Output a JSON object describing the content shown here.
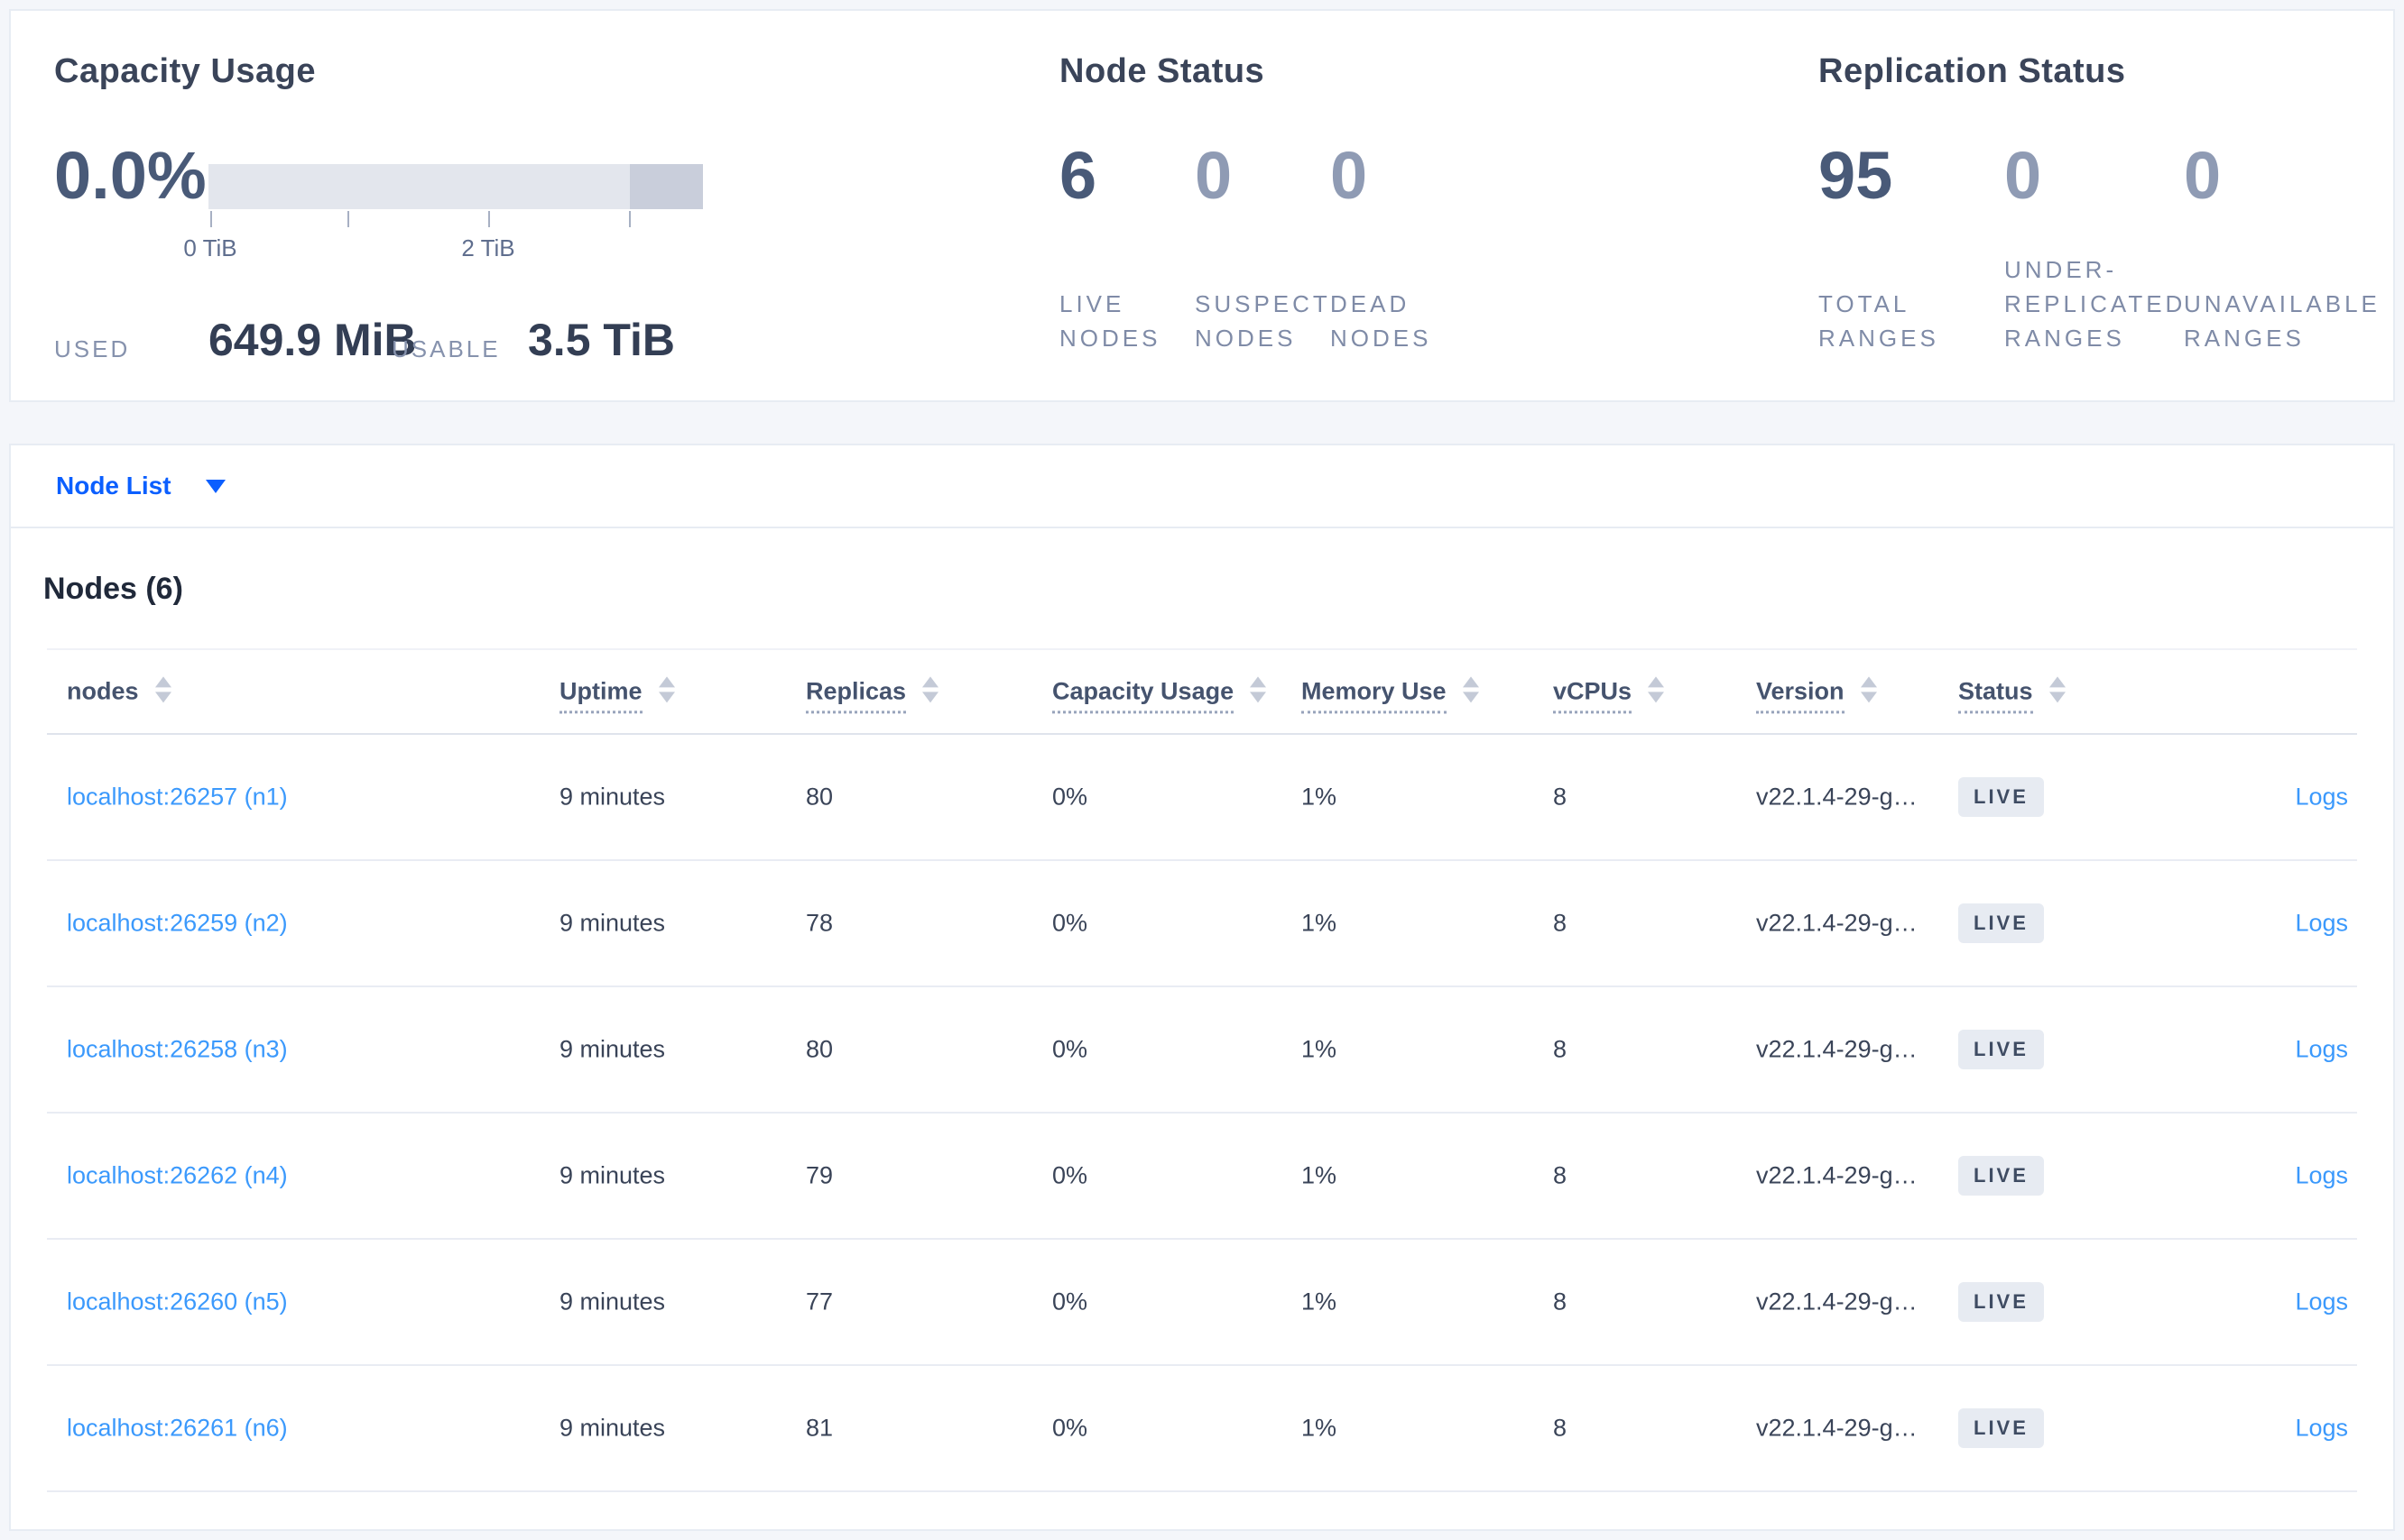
{
  "overview": {
    "capacity": {
      "title": "Capacity Usage",
      "percent": "0.0%",
      "tick_labels": [
        "0 TiB",
        "2 TiB"
      ],
      "used_label": "USED",
      "used_value": "649.9 MiB",
      "usable_label": "USABLE",
      "usable_value": "3.5 TiB"
    },
    "node_status": {
      "title": "Node Status",
      "stats": [
        {
          "value": "6",
          "label": "LIVE\nNODES"
        },
        {
          "value": "0",
          "label": "SUSPECT\nNODES"
        },
        {
          "value": "0",
          "label": "DEAD\nNODES"
        }
      ]
    },
    "replication": {
      "title": "Replication Status",
      "stats": [
        {
          "value": "95",
          "label": "TOTAL\nRANGES"
        },
        {
          "value": "0",
          "label": "UNDER-\nREPLICATED\nRANGES"
        },
        {
          "value": "0",
          "label": "UNAVAILABLE\nRANGES"
        }
      ]
    }
  },
  "node_list": {
    "selector_label": "Node List"
  },
  "nodes_section": {
    "title": "Nodes (6)",
    "columns": [
      "nodes",
      "Uptime",
      "Replicas",
      "Capacity Usage",
      "Memory Use",
      "vCPUs",
      "Version",
      "Status"
    ],
    "rows": [
      {
        "node": "localhost:26257 (n1)",
        "uptime": "9 minutes",
        "replicas": "80",
        "capacity": "0%",
        "memory": "1%",
        "vcpus": "8",
        "version": "v22.1.4-29-g…",
        "status": "LIVE",
        "logs": "Logs"
      },
      {
        "node": "localhost:26259 (n2)",
        "uptime": "9 minutes",
        "replicas": "78",
        "capacity": "0%",
        "memory": "1%",
        "vcpus": "8",
        "version": "v22.1.4-29-g…",
        "status": "LIVE",
        "logs": "Logs"
      },
      {
        "node": "localhost:26258 (n3)",
        "uptime": "9 minutes",
        "replicas": "80",
        "capacity": "0%",
        "memory": "1%",
        "vcpus": "8",
        "version": "v22.1.4-29-g…",
        "status": "LIVE",
        "logs": "Logs"
      },
      {
        "node": "localhost:26262 (n4)",
        "uptime": "9 minutes",
        "replicas": "79",
        "capacity": "0%",
        "memory": "1%",
        "vcpus": "8",
        "version": "v22.1.4-29-g…",
        "status": "LIVE",
        "logs": "Logs"
      },
      {
        "node": "localhost:26260 (n5)",
        "uptime": "9 minutes",
        "replicas": "77",
        "capacity": "0%",
        "memory": "1%",
        "vcpus": "8",
        "version": "v22.1.4-29-g…",
        "status": "LIVE",
        "logs": "Logs"
      },
      {
        "node": "localhost:26261 (n6)",
        "uptime": "9 minutes",
        "replicas": "81",
        "capacity": "0%",
        "memory": "1%",
        "vcpus": "8",
        "version": "v22.1.4-29-g…",
        "status": "LIVE",
        "logs": "Logs"
      }
    ]
  },
  "colors": {
    "accent_blue": "#0b5fff",
    "link_blue": "#3b99fc",
    "badge_bg": "#e7ebf2",
    "badge_text": "#3f4c63",
    "bar_track": "#e3e6ed",
    "bar_segment": "#c9cedb",
    "page_bg": "#f4f6fa"
  }
}
